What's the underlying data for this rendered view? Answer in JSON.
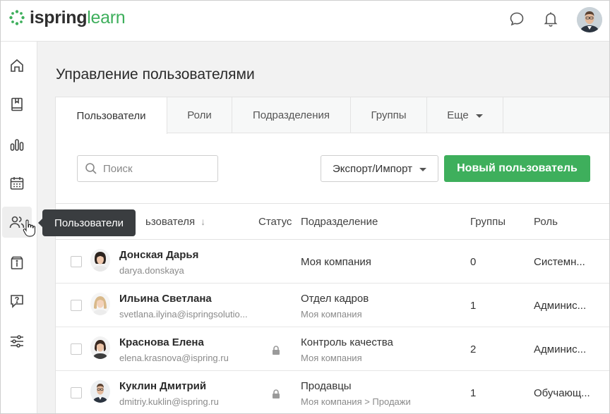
{
  "header": {
    "logo_part1": "ispring",
    "logo_part2": "learn",
    "icons": [
      "chat-icon",
      "bell-icon"
    ]
  },
  "sidebar": {
    "items": [
      {
        "icon": "home-icon"
      },
      {
        "icon": "book-icon"
      },
      {
        "icon": "bar-chart-icon"
      },
      {
        "icon": "calendar-icon"
      },
      {
        "icon": "users-icon",
        "active": true
      },
      {
        "icon": "info-box-icon"
      },
      {
        "icon": "question-icon"
      },
      {
        "icon": "sliders-icon"
      }
    ]
  },
  "tooltip": "Пользователи",
  "page_title": "Управление пользователями",
  "tabs": [
    "Пользователи",
    "Роли",
    "Подразделения",
    "Группы",
    "Еще"
  ],
  "toolbar": {
    "search_placeholder": "Поиск",
    "export_label": "Экспорт/Импорт",
    "new_user_label": "Новый пользователь"
  },
  "table": {
    "columns": {
      "user": "ьзователя",
      "status": "Статус",
      "department": "Подразделение",
      "groups": "Группы",
      "role": "Роль"
    },
    "rows": [
      {
        "name": "Донская Дарья",
        "login": "darya.donskaya",
        "locked": false,
        "department": "Моя компания",
        "department_path": "",
        "groups": "0",
        "role": "Системн..."
      },
      {
        "name": "Ильина Светлана",
        "login": "svetlana.ilyina@ispringsolutio...",
        "locked": false,
        "department": "Отдел кадров",
        "department_path": "Моя компания",
        "groups": "1",
        "role": "Админис..."
      },
      {
        "name": "Краснова Елена",
        "login": "elena.krasnova@ispring.ru",
        "locked": true,
        "department": "Контроль качества",
        "department_path": "Моя компания",
        "groups": "2",
        "role": "Админис..."
      },
      {
        "name": "Куклин Дмитрий",
        "login": "dmitriy.kuklin@ispring.ru",
        "locked": true,
        "department": "Продавцы",
        "department_path": "Моя компания > Продажи",
        "groups": "1",
        "role": "Обучающ..."
      }
    ]
  },
  "colors": {
    "brand_green": "#3eaf5c",
    "tooltip_bg": "#3a3d40"
  }
}
